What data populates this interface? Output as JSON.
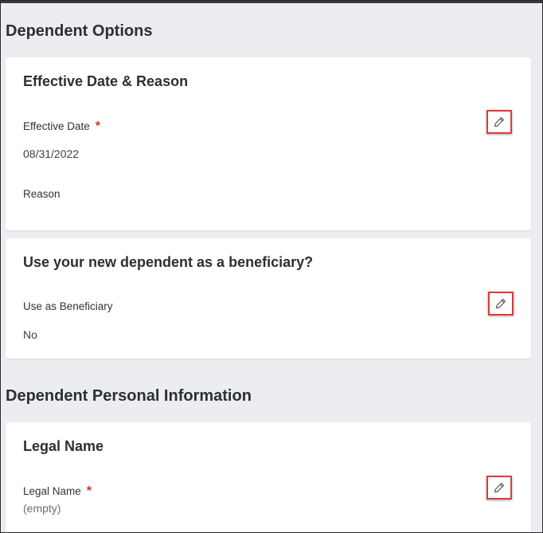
{
  "sections": {
    "dependent_options": {
      "title": "Dependent Options"
    },
    "personal_info": {
      "title": "Dependent Personal Information"
    }
  },
  "effective_card": {
    "title": "Effective Date & Reason",
    "effective_date_label": "Effective Date",
    "required_mark": "*",
    "effective_date_value": "08/31/2022",
    "reason_label": "Reason"
  },
  "beneficiary_card": {
    "title": "Use your new dependent as a beneficiary?",
    "use_label": "Use as Beneficiary",
    "use_value": "No"
  },
  "legal_name_card": {
    "title": "Legal Name",
    "legal_name_label": "Legal Name",
    "required_mark": "*",
    "legal_name_value": "(empty)"
  },
  "icons": {
    "edit": "pencil-icon"
  },
  "colors": {
    "required": "#de2e21",
    "highlight_border": "#e0393a",
    "background": "#ecedf0"
  }
}
